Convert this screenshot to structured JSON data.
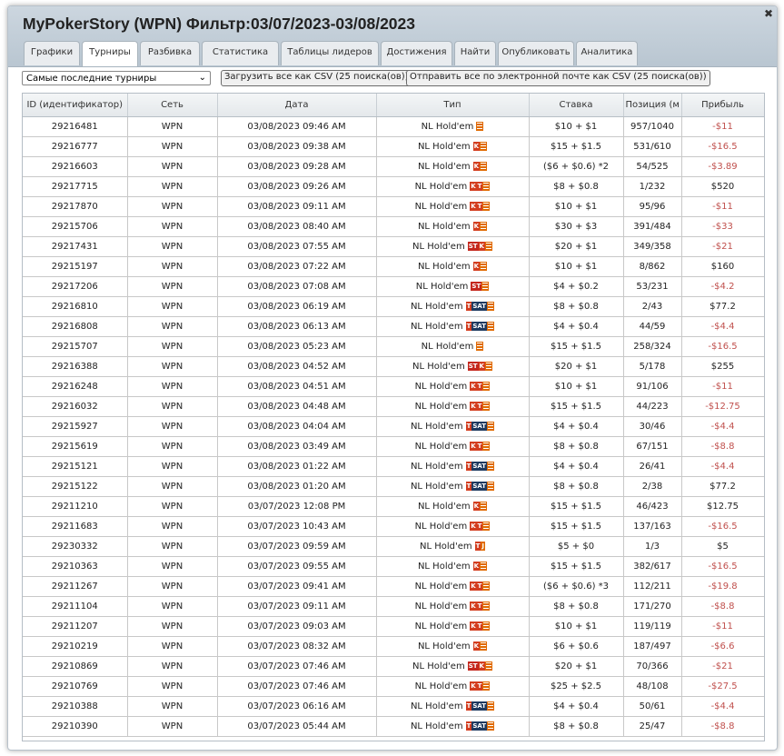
{
  "window": {
    "title": "MyPokerStory (WPN) Фильтр:03/07/2023-03/08/2023",
    "close_icon": "close-icon"
  },
  "tabs": [
    {
      "label": "Графики",
      "active": false
    },
    {
      "label": "Турниры",
      "active": true
    },
    {
      "label": "Разбивка",
      "active": false
    },
    {
      "label": "Статистика",
      "active": false
    },
    {
      "label": "Таблицы лидеров",
      "active": false
    },
    {
      "label": "Достижения",
      "active": false
    },
    {
      "label": "Найти",
      "active": false
    },
    {
      "label": "Опубликовать",
      "active": false
    },
    {
      "label": "Аналитика",
      "active": false
    }
  ],
  "toolbar": {
    "filter_value": "Самые последние турниры",
    "csv_button": "Загрузить все как CSV (25 поиска(ов))",
    "email_button": "Отправить все по электронной почте как CSV (25 поиска(ов))"
  },
  "table": {
    "columns": [
      "ID (идентификатор)",
      "Сеть",
      "Дата",
      "Тип",
      "Ставка",
      "Позиция (м",
      "Прибыль"
    ],
    "rows": [
      {
        "id": "29216481",
        "net": "WPN",
        "date": "03/08/2023 09:46 AM",
        "type": "NL Hold'em",
        "badges": [
          "E"
        ],
        "stake": "$10 + $1",
        "pos": "957/1040",
        "profit": "-$11"
      },
      {
        "id": "29216777",
        "net": "WPN",
        "date": "03/08/2023 09:38 AM",
        "type": "NL Hold'em",
        "badges": [
          "K",
          "E"
        ],
        "stake": "$15 + $1.5",
        "pos": "531/610",
        "profit": "-$16.5"
      },
      {
        "id": "29216603",
        "net": "WPN",
        "date": "03/08/2023 09:28 AM",
        "type": "NL Hold'em",
        "badges": [
          "K",
          "E"
        ],
        "stake": "($6 + $0.6) *2",
        "pos": "54/525",
        "profit": "-$3.89"
      },
      {
        "id": "29217715",
        "net": "WPN",
        "date": "03/08/2023 09:26 AM",
        "type": "NL Hold'em",
        "badges": [
          "K",
          "T",
          "E"
        ],
        "stake": "$8 + $0.8",
        "pos": "1/232",
        "profit": "$520"
      },
      {
        "id": "29217870",
        "net": "WPN",
        "date": "03/08/2023 09:11 AM",
        "type": "NL Hold'em",
        "badges": [
          "K",
          "T",
          "E"
        ],
        "stake": "$10 + $1",
        "pos": "95/96",
        "profit": "-$11"
      },
      {
        "id": "29215706",
        "net": "WPN",
        "date": "03/08/2023 08:40 AM",
        "type": "NL Hold'em",
        "badges": [
          "K",
          "E"
        ],
        "stake": "$30 + $3",
        "pos": "391/484",
        "profit": "-$33"
      },
      {
        "id": "29217431",
        "net": "WPN",
        "date": "03/08/2023 07:55 AM",
        "type": "NL Hold'em",
        "badges": [
          "ST",
          "K",
          "E"
        ],
        "stake": "$20 + $1",
        "pos": "349/358",
        "profit": "-$21"
      },
      {
        "id": "29215197",
        "net": "WPN",
        "date": "03/08/2023 07:22 AM",
        "type": "NL Hold'em",
        "badges": [
          "K",
          "E"
        ],
        "stake": "$10 + $1",
        "pos": "8/862",
        "profit": "$160"
      },
      {
        "id": "29217206",
        "net": "WPN",
        "date": "03/08/2023 07:08 AM",
        "type": "NL Hold'em",
        "badges": [
          "ST",
          "E"
        ],
        "stake": "$4 + $0.2",
        "pos": "53/231",
        "profit": "-$4.2"
      },
      {
        "id": "29216810",
        "net": "WPN",
        "date": "03/08/2023 06:19 AM",
        "type": "NL Hold'em",
        "badges": [
          "T",
          "SAT",
          "E"
        ],
        "stake": "$8 + $0.8",
        "pos": "2/43",
        "profit": "$77.2"
      },
      {
        "id": "29216808",
        "net": "WPN",
        "date": "03/08/2023 06:13 AM",
        "type": "NL Hold'em",
        "badges": [
          "T",
          "SAT",
          "E"
        ],
        "stake": "$4 + $0.4",
        "pos": "44/59",
        "profit": "-$4.4"
      },
      {
        "id": "29215707",
        "net": "WPN",
        "date": "03/08/2023 05:23 AM",
        "type": "NL Hold'em",
        "badges": [
          "E"
        ],
        "stake": "$15 + $1.5",
        "pos": "258/324",
        "profit": "-$16.5"
      },
      {
        "id": "29216388",
        "net": "WPN",
        "date": "03/08/2023 04:52 AM",
        "type": "NL Hold'em",
        "badges": [
          "ST",
          "K",
          "E"
        ],
        "stake": "$20 + $1",
        "pos": "5/178",
        "profit": "$255"
      },
      {
        "id": "29216248",
        "net": "WPN",
        "date": "03/08/2023 04:51 AM",
        "type": "NL Hold'em",
        "badges": [
          "K",
          "T",
          "E"
        ],
        "stake": "$10 + $1",
        "pos": "91/106",
        "profit": "-$11"
      },
      {
        "id": "29216032",
        "net": "WPN",
        "date": "03/08/2023 04:48 AM",
        "type": "NL Hold'em",
        "badges": [
          "K",
          "T",
          "E"
        ],
        "stake": "$15 + $1.5",
        "pos": "44/223",
        "profit": "-$12.75"
      },
      {
        "id": "29215927",
        "net": "WPN",
        "date": "03/08/2023 04:04 AM",
        "type": "NL Hold'em",
        "badges": [
          "T",
          "SAT",
          "E"
        ],
        "stake": "$4 + $0.4",
        "pos": "30/46",
        "profit": "-$4.4"
      },
      {
        "id": "29215619",
        "net": "WPN",
        "date": "03/08/2023 03:49 AM",
        "type": "NL Hold'em",
        "badges": [
          "K",
          "T",
          "E"
        ],
        "stake": "$8 + $0.8",
        "pos": "67/151",
        "profit": "-$8.8"
      },
      {
        "id": "29215121",
        "net": "WPN",
        "date": "03/08/2023 01:22 AM",
        "type": "NL Hold'em",
        "badges": [
          "T",
          "SAT",
          "E"
        ],
        "stake": "$4 + $0.4",
        "pos": "26/41",
        "profit": "-$4.4"
      },
      {
        "id": "29215122",
        "net": "WPN",
        "date": "03/08/2023 01:20 AM",
        "type": "NL Hold'em",
        "badges": [
          "T",
          "SAT",
          "E"
        ],
        "stake": "$8 + $0.8",
        "pos": "2/38",
        "profit": "$77.2"
      },
      {
        "id": "29211210",
        "net": "WPN",
        "date": "03/07/2023 12:08 PM",
        "type": "NL Hold'em",
        "badges": [
          "K",
          "E"
        ],
        "stake": "$15 + $1.5",
        "pos": "46/423",
        "profit": "$12.75"
      },
      {
        "id": "29211683",
        "net": "WPN",
        "date": "03/07/2023 10:43 AM",
        "type": "NL Hold'em",
        "badges": [
          "K",
          "T",
          "E"
        ],
        "stake": "$15 + $1.5",
        "pos": "137/163",
        "profit": "-$16.5"
      },
      {
        "id": "29230332",
        "net": "WPN",
        "date": "03/07/2023 09:59 AM",
        "type": "NL Hold'em",
        "badges": [
          "T",
          "J"
        ],
        "stake": "$5 + $0",
        "pos": "1/3",
        "profit": "$5"
      },
      {
        "id": "29210363",
        "net": "WPN",
        "date": "03/07/2023 09:55 AM",
        "type": "NL Hold'em",
        "badges": [
          "K",
          "E"
        ],
        "stake": "$15 + $1.5",
        "pos": "382/617",
        "profit": "-$16.5"
      },
      {
        "id": "29211267",
        "net": "WPN",
        "date": "03/07/2023 09:41 AM",
        "type": "NL Hold'em",
        "badges": [
          "K",
          "T",
          "E"
        ],
        "stake": "($6 + $0.6) *3",
        "pos": "112/211",
        "profit": "-$19.8"
      },
      {
        "id": "29211104",
        "net": "WPN",
        "date": "03/07/2023 09:11 AM",
        "type": "NL Hold'em",
        "badges": [
          "K",
          "T",
          "E"
        ],
        "stake": "$8 + $0.8",
        "pos": "171/270",
        "profit": "-$8.8"
      },
      {
        "id": "29211207",
        "net": "WPN",
        "date": "03/07/2023 09:03 AM",
        "type": "NL Hold'em",
        "badges": [
          "K",
          "T",
          "E"
        ],
        "stake": "$10 + $1",
        "pos": "119/119",
        "profit": "-$11"
      },
      {
        "id": "29210219",
        "net": "WPN",
        "date": "03/07/2023 08:32 AM",
        "type": "NL Hold'em",
        "badges": [
          "K",
          "E"
        ],
        "stake": "$6 + $0.6",
        "pos": "187/497",
        "profit": "-$6.6"
      },
      {
        "id": "29210869",
        "net": "WPN",
        "date": "03/07/2023 07:46 AM",
        "type": "NL Hold'em",
        "badges": [
          "ST",
          "K",
          "E"
        ],
        "stake": "$20 + $1",
        "pos": "70/366",
        "profit": "-$21"
      },
      {
        "id": "29210769",
        "net": "WPN",
        "date": "03/07/2023 07:46 AM",
        "type": "NL Hold'em",
        "badges": [
          "K",
          "T",
          "E"
        ],
        "stake": "$25 + $2.5",
        "pos": "48/108",
        "profit": "-$27.5"
      },
      {
        "id": "29210388",
        "net": "WPN",
        "date": "03/07/2023 06:16 AM",
        "type": "NL Hold'em",
        "badges": [
          "T",
          "SAT",
          "E"
        ],
        "stake": "$4 + $0.4",
        "pos": "50/61",
        "profit": "-$4.4"
      },
      {
        "id": "29210390",
        "net": "WPN",
        "date": "03/07/2023 05:44 AM",
        "type": "NL Hold'em",
        "badges": [
          "T",
          "SAT",
          "E"
        ],
        "stake": "$8 + $0.8",
        "pos": "25/47",
        "profit": "-$8.8"
      }
    ]
  },
  "colors": {
    "negative_profit": "#c0504d",
    "badge_red": "#d33d1f",
    "badge_orange": "#e06a00",
    "badge_navy": "#1f3a60"
  }
}
